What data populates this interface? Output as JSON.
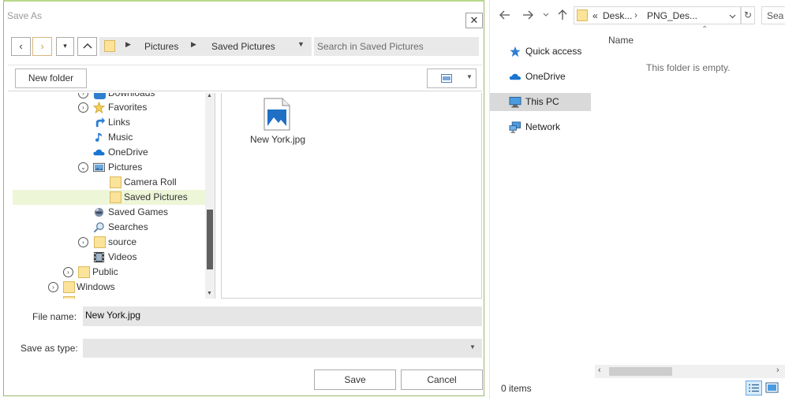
{
  "dialog": {
    "title": "Save As",
    "close_glyph": "✕",
    "nav": {
      "back": "‹",
      "forward": "›",
      "recent": "▾",
      "up": "‹"
    },
    "address": {
      "segments": [
        "Pictures",
        "Saved Pictures"
      ]
    },
    "search_placeholder": "Search in Saved Pictures",
    "new_folder_label": "New folder",
    "tree": [
      {
        "label": "Downloads",
        "icon": "downloads-icon"
      },
      {
        "label": "Favorites",
        "icon": "star-icon"
      },
      {
        "label": "Links",
        "icon": "link-icon"
      },
      {
        "label": "Music",
        "icon": "music-icon"
      },
      {
        "label": "OneDrive",
        "icon": "cloud-icon"
      },
      {
        "label": "Pictures",
        "icon": "pictures-icon"
      },
      {
        "label": "Camera Roll",
        "icon": "folder-icon"
      },
      {
        "label": "Saved Pictures",
        "icon": "folder-icon"
      },
      {
        "label": "Saved Games",
        "icon": "games-icon"
      },
      {
        "label": "Searches",
        "icon": "search-icon"
      },
      {
        "label": "source",
        "icon": "folder-icon"
      },
      {
        "label": "Videos",
        "icon": "video-icon"
      },
      {
        "label": "Public",
        "icon": "folder-icon"
      },
      {
        "label": "Windows",
        "icon": "folder-icon"
      }
    ],
    "files": [
      {
        "name": "New York.jpg",
        "icon": "image-file-icon"
      }
    ],
    "file_name_label": "File name:",
    "file_name_value": "New York.jpg",
    "save_type_label": "Save as type:",
    "save_type_value": "",
    "save_button": "Save",
    "cancel_button": "Cancel"
  },
  "explorer": {
    "address": {
      "overflow": "«",
      "segments": [
        "Desk...",
        "PNG_Des..."
      ]
    },
    "search_placeholder": "Sea",
    "nav_pane": [
      {
        "label": "Quick access",
        "icon": "star-icon"
      },
      {
        "label": "OneDrive",
        "icon": "cloud-icon"
      },
      {
        "label": "This PC",
        "icon": "computer-icon",
        "selected": true
      },
      {
        "label": "Network",
        "icon": "network-icon"
      }
    ],
    "column_header": "Name",
    "empty_message": "This folder is empty.",
    "status": "0 items"
  }
}
